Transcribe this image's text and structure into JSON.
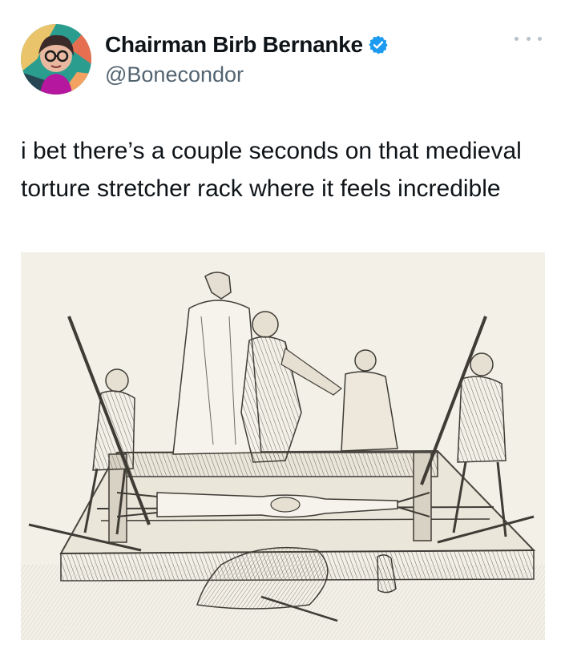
{
  "author": {
    "display_name": "Chairman Birb Bernanke",
    "handle": "@Bonecondor",
    "avatar_icon": "profile-avatar",
    "verified_icon": "verified-badge-icon",
    "verified_color": "#1d9bf0"
  },
  "menu": {
    "icon": "more-options-icon"
  },
  "tweet": {
    "text": "i bet there’s a couple seconds on that medieval torture stretcher rack where it feels incredible"
  },
  "media": {
    "icon": "engraving-image"
  },
  "colors": {
    "text_primary": "#0f1419",
    "text_secondary": "#536471",
    "image_paper": "#f3f0e8"
  }
}
